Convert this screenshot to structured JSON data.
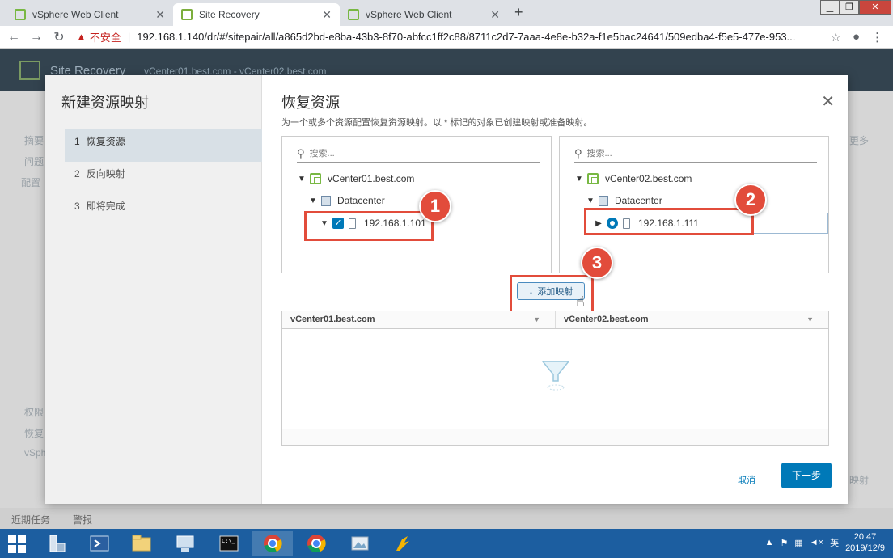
{
  "browser": {
    "tabs": [
      {
        "title": "vSphere Web Client",
        "active": false
      },
      {
        "title": "Site Recovery",
        "active": true
      },
      {
        "title": "vSphere Web Client",
        "active": false
      }
    ],
    "insecure_label": "不安全",
    "url": "192.168.1.140/dr/#/sitepair/all/a865d2bd-e8ba-43b3-8f70-abfcc1ff2c88/8711c2d7-7aaa-4e8e-b32a-f1e5bac24641/509edba4-f5e5-477e-953..."
  },
  "app": {
    "title": "Site Recovery",
    "vcenters": "vCenter01.best.com - vCenter02.best.com",
    "bg_items": [
      "摘要",
      "问题",
      "配置",
      "权限",
      "恢复",
      "vSph",
      "更多"
    ],
    "bottom_tabs": [
      "近期任务",
      "警报"
    ],
    "bg_button": "映射"
  },
  "wizard": {
    "title": "新建资源映射",
    "steps": [
      {
        "num": "1",
        "label": "恢复资源",
        "active": true
      },
      {
        "num": "2",
        "label": "反向映射",
        "active": false
      },
      {
        "num": "3",
        "label": "即将完成",
        "active": false
      }
    ],
    "page_title": "恢复资源",
    "page_desc": "为一个或多个资源配置恢复资源映射。以 * 标记的对象已创建映射或准备映射。",
    "left_panel": {
      "search_placeholder": "搜索...",
      "vcenter": "vCenter01.best.com",
      "datacenter": "Datacenter",
      "host": "192.168.1.101"
    },
    "right_panel": {
      "search_placeholder": "搜索...",
      "vcenter": "vCenter02.best.com",
      "datacenter": "Datacenter",
      "host": "192.168.1.111"
    },
    "add_mapping_label": "添加映射",
    "grid": {
      "columns": [
        "vCenter01.best.com",
        "vCenter02.best.com"
      ]
    },
    "cancel_label": "取消",
    "next_label": "下一步"
  },
  "callouts": [
    "1",
    "2",
    "3"
  ],
  "taskbar": {
    "lang": "英",
    "time": "20:47",
    "date": "2019/12/9"
  },
  "colors": {
    "accent": "#0079b8",
    "callout": "#e24c3b",
    "taskbar": "#1c5ea0"
  }
}
